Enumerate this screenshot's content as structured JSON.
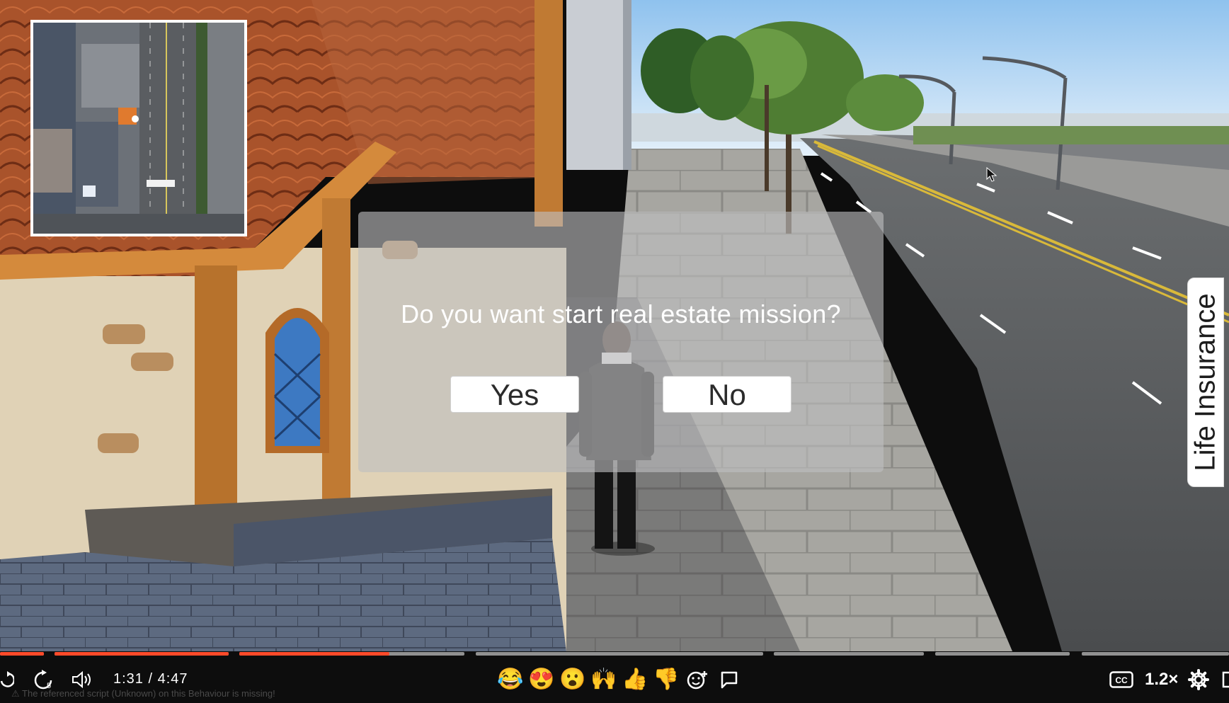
{
  "dialog": {
    "question": "Do you want start real estate mission?",
    "yes_label": "Yes",
    "no_label": "No"
  },
  "side_tab": {
    "label": "Life Insurance"
  },
  "player": {
    "current_time": "1:31",
    "separator": "/",
    "duration": "4:47",
    "progress_fraction": 0.317,
    "speed_label": "1.2×",
    "cc_label": "CC",
    "skip_seconds": "5",
    "accent_color": "#ff4a2a",
    "reactions": [
      "😂",
      "😍",
      "😮",
      "🙌",
      "👍",
      "👎"
    ]
  },
  "console": {
    "message": "The referenced script (Unknown) on this Behaviour is missing!"
  }
}
